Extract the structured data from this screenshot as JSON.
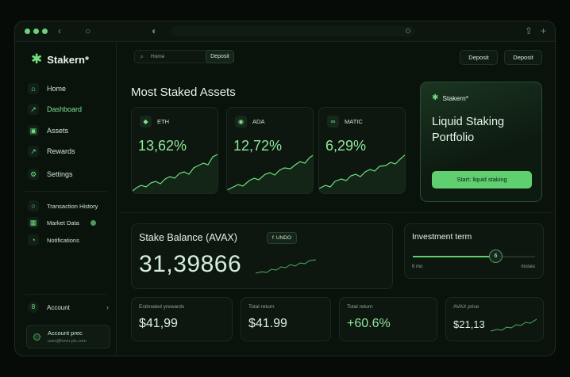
{
  "app": {
    "brand": "Stakern*"
  },
  "colors": {
    "accent": "#5fcf6f",
    "background": "#0a120c",
    "card": "#0d1710"
  },
  "sidebar": {
    "items": [
      {
        "label": "Home",
        "icon": "home-icon"
      },
      {
        "label": "Dashboard",
        "icon": "chart-line-icon",
        "active": true
      },
      {
        "label": "Assets",
        "icon": "wallet-icon"
      },
      {
        "label": "Rewards",
        "icon": "trend-icon"
      },
      {
        "label": "Settings",
        "icon": "gear-icon"
      }
    ],
    "secondary": [
      {
        "label": "Transaction History",
        "icon": "history-icon"
      },
      {
        "label": "Market Data",
        "icon": "grid-icon"
      },
      {
        "label": "Notifications",
        "icon": "bell-icon"
      }
    ],
    "account_label": "Account",
    "account_card": {
      "name": "Account prec",
      "email": "user@hevn.plc.com"
    }
  },
  "topbar": {
    "search_placeholder": "Home",
    "search_button": "Deposit",
    "btn1": "Deposit",
    "btn2": "Deposit"
  },
  "assets": {
    "title": "Most Staked Assets",
    "cards": [
      {
        "symbol": "ETH",
        "percent": "13,62%"
      },
      {
        "symbol": "ADA",
        "percent": "12,72%"
      },
      {
        "symbol": "MATIC",
        "percent": "6,29%"
      }
    ]
  },
  "promo": {
    "brand": "Stakern*",
    "title": "Liquid Staking Portfolio",
    "cta": "Start: liquid staking"
  },
  "balance": {
    "title": "Stake Balance (AVAX)",
    "undo_label": "UNDO",
    "value": "31,39866"
  },
  "investment": {
    "title": "Investment term",
    "value": "6",
    "min_label": "6 mo",
    "max_label": "moses",
    "level": 0.7
  },
  "stats": [
    {
      "label": "Estimated yrewards",
      "value": "$41,99"
    },
    {
      "label": "Total return",
      "value": "$41.99"
    },
    {
      "label": "Total return",
      "value": "+60.6%"
    },
    {
      "label": "AVAX price",
      "value": "$21,13"
    }
  ]
}
